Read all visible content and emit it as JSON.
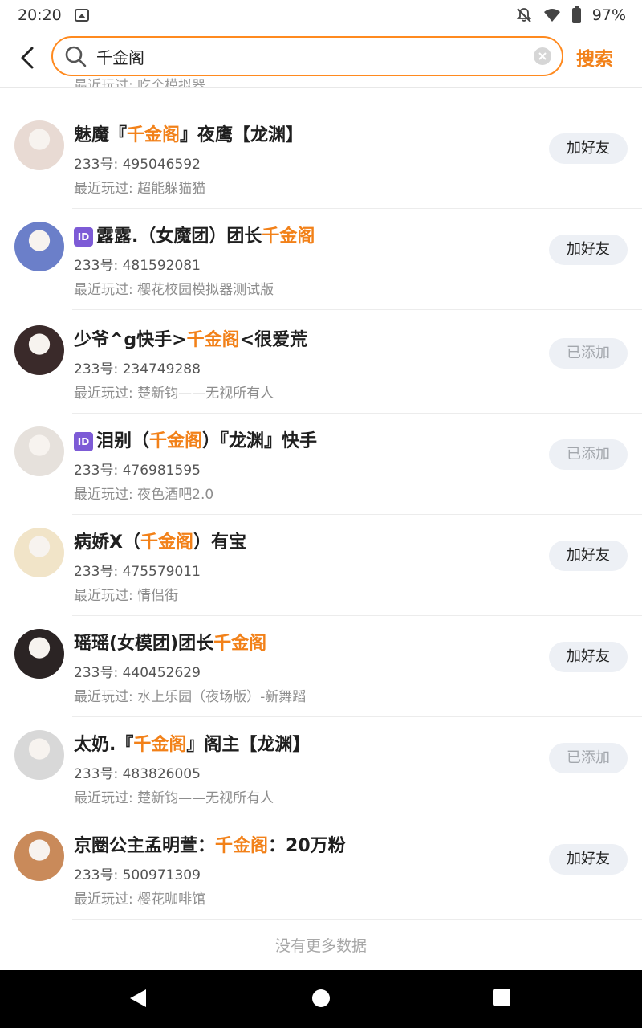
{
  "status": {
    "time": "20:20",
    "battery": "97%"
  },
  "search": {
    "query": "千金阁",
    "button_label": "搜索"
  },
  "clipped_row_text": "最近玩过: 吃个模拟器",
  "results": [
    {
      "name_pre": "魅魔『",
      "name_hl": "千金阁",
      "name_post": "』夜鹰【龙渊】",
      "id_badge": false,
      "uid": "233号: 495046592",
      "recent": "最近玩过: 超能躲猫猫",
      "action": "加好友",
      "added": false,
      "avatar_bg": "#e8dad3"
    },
    {
      "name_pre": "露露.（女魔团）团长",
      "name_hl": "千金阁",
      "name_post": "",
      "id_badge": true,
      "uid": "233号: 481592081",
      "recent": "最近玩过: 樱花校园模拟器测试版",
      "action": "加好友",
      "added": false,
      "avatar_bg": "#6b7fc9"
    },
    {
      "name_pre": "少爷^g快手>",
      "name_hl": "千金阁",
      "name_post": "<很爱荒",
      "id_badge": false,
      "uid": "233号: 234749288",
      "recent": "最近玩过: 楚新钧——无视所有人",
      "action": "已添加",
      "added": true,
      "avatar_bg": "#3a2a2a"
    },
    {
      "name_pre": "泪别（",
      "name_hl": "千金阁",
      "name_post": "）『龙渊』快手",
      "id_badge": true,
      "uid": "233号: 476981595",
      "recent": "最近玩过: 夜色酒吧2.0",
      "action": "已添加",
      "added": true,
      "avatar_bg": "#e6e1dc"
    },
    {
      "name_pre": "病娇X（",
      "name_hl": "千金阁",
      "name_post": "）有宝",
      "id_badge": false,
      "uid": "233号: 475579011",
      "recent": "最近玩过: 情侣街",
      "action": "加好友",
      "added": false,
      "avatar_bg": "#f1e4c8"
    },
    {
      "name_pre": "瑶瑶(女模团)团长",
      "name_hl": "千金阁",
      "name_post": "",
      "id_badge": false,
      "uid": "233号: 440452629",
      "recent": "最近玩过: 水上乐园（夜场版）-新舞蹈",
      "action": "加好友",
      "added": false,
      "avatar_bg": "#2b2424"
    },
    {
      "name_pre": "太奶.『",
      "name_hl": "千金阁",
      "name_post": "』阁主【龙渊】",
      "id_badge": false,
      "uid": "233号: 483826005",
      "recent": "最近玩过: 楚新钧——无视所有人",
      "action": "已添加",
      "added": true,
      "avatar_bg": "#d8d8d8"
    },
    {
      "name_pre": "京圈公主孟明萱：",
      "name_hl": "千金阁",
      "name_post": "：20万粉",
      "id_badge": false,
      "uid": "233号: 500971309",
      "recent": "最近玩过: 樱花咖啡馆",
      "action": "加好友",
      "added": false,
      "avatar_bg": "#c98a5a"
    }
  ],
  "footer": {
    "no_more_text": "没有更多数据"
  },
  "colors": {
    "accent": "#f28119",
    "id_badge": "#7d5bd6"
  }
}
